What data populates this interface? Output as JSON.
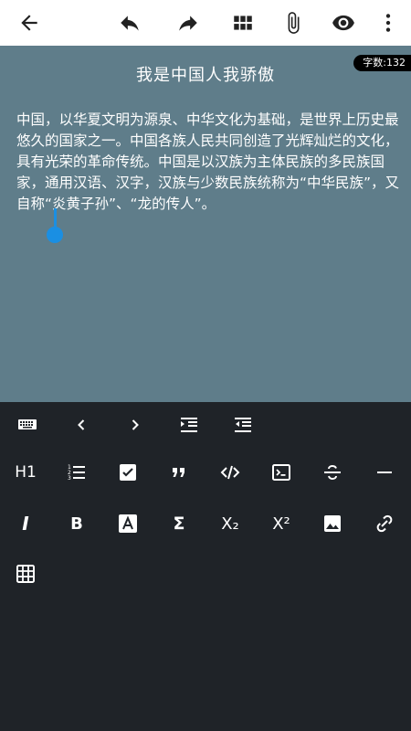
{
  "topbar": {
    "icons": [
      "back-arrow-icon",
      "undo-icon",
      "redo-icon",
      "grid-icon",
      "attachment-icon",
      "preview-eye-icon",
      "more-vert-icon"
    ]
  },
  "editor": {
    "title": "我是中国人我骄傲",
    "word_count": "字数:132",
    "content": "中国，以华夏文明为源泉、中华文化为基础，是世界上历史最悠久的国家之一。中国各族人民共同创造了光辉灿烂的文化，具有光荣的革命传统。中国是以汉族为主体民族的多民族国家，通用汉语、汉字，汉族与少数民族统称为“中华民族”，又自称“炎黄子孙”、“龙的传人”。",
    "accent": "#1a8fe3",
    "background": "#5f7d8a"
  },
  "toolbar": {
    "heading_label": "H1",
    "subscript_label": "X₂",
    "superscript_label": "X²",
    "bold_label": "B",
    "italic_label": "I",
    "sigma_label": "Σ"
  }
}
